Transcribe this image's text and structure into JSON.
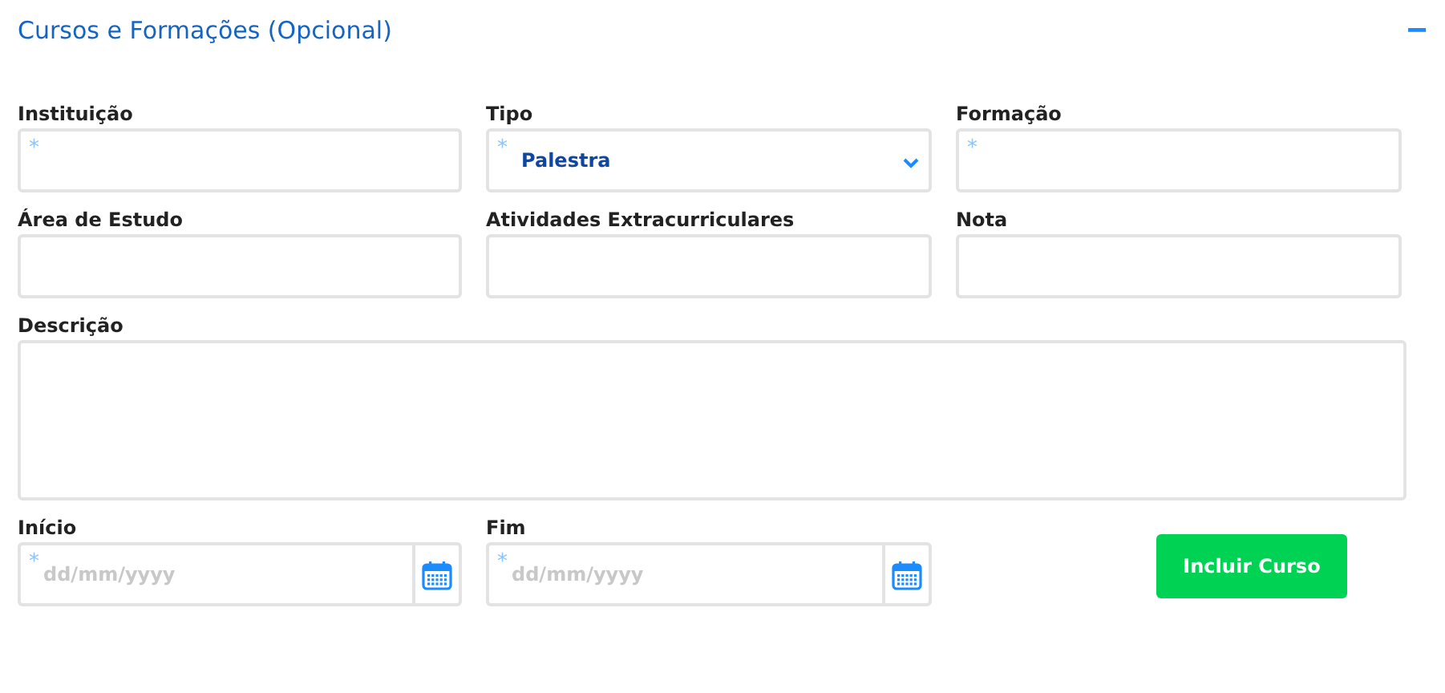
{
  "section": {
    "title": "Cursos e Formações (Opcional)",
    "collapse_icon": "−"
  },
  "rows": [
    [
      {
        "kind": "text",
        "label": "Instituição",
        "mark": "*"
      },
      {
        "kind": "select",
        "label": "Tipo",
        "mark": "*",
        "value": "Palestra"
      },
      {
        "kind": "text",
        "label": "Formação",
        "mark": "*"
      }
    ],
    [
      {
        "kind": "text",
        "label": "Área de Estudo"
      },
      {
        "kind": "text",
        "label": "Atividades Extracurriculares"
      },
      {
        "kind": "text",
        "label": "Nota"
      }
    ],
    [
      {
        "kind": "textarea",
        "label": "Descrição"
      }
    ],
    [
      {
        "kind": "date",
        "label": "Início",
        "mark": "*",
        "placeholder": "dd/mm/yyyy"
      },
      {
        "kind": "date",
        "label": "Fim",
        "mark": "*",
        "placeholder": "dd/mm/yyyy"
      },
      {
        "kind": "button",
        "label": "Incluir Curso"
      }
    ]
  ]
}
